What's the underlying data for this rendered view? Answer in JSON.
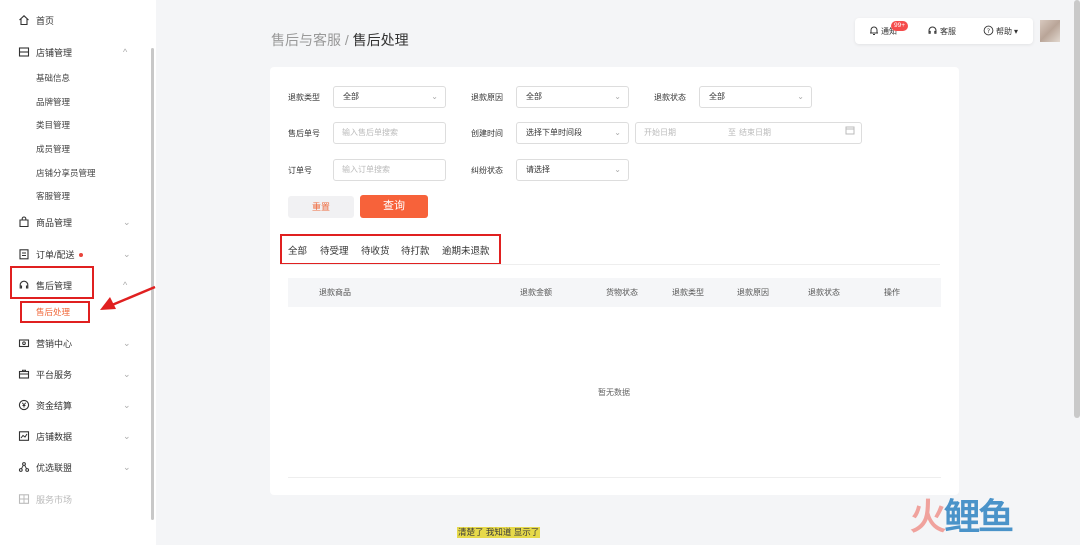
{
  "sidebar": {
    "home": "首页",
    "store_mgmt": "店铺管理",
    "store_sub": [
      "基础信息",
      "品牌管理",
      "类目管理",
      "成员管理",
      "店铺分享员管理",
      "客服管理"
    ],
    "product_mgmt": "商品管理",
    "orders": "订单/配送",
    "after_sales": "售后管理",
    "after_sales_sub": "售后处理",
    "marketing": "营销中心",
    "platform": "平台服务",
    "finance": "资金结算",
    "data": "店铺数据",
    "alliance": "优选联盟",
    "market": "服务市场"
  },
  "header": {
    "breadcrumb_parent": "售后与客服",
    "breadcrumb_sep": " / ",
    "breadcrumb_current": "售后处理",
    "notice": "通知",
    "notice_badge": "99+",
    "service": "客服",
    "help": "帮助"
  },
  "filters": {
    "refund_type_label": "退款类型",
    "refund_type_value": "全部",
    "refund_reason_label": "退款原因",
    "refund_reason_value": "全部",
    "refund_status_label": "退款状态",
    "refund_status_value": "全部",
    "after_sale_no_label": "售后单号",
    "after_sale_no_placeholder": "输入售后单搜索",
    "create_time_label": "创建时间",
    "create_time_value": "选择下单时间段",
    "start_date_placeholder": "开始日期",
    "date_sep": "至",
    "end_date_placeholder": "结束日期",
    "order_no_label": "订单号",
    "order_no_placeholder": "输入订单搜索",
    "dispute_label": "纠纷状态",
    "dispute_value": "请选择",
    "reset": "重置",
    "query": "查询"
  },
  "tabs": [
    "全部",
    "待受理",
    "待收货",
    "待打款",
    "逾期未退款"
  ],
  "table": {
    "headers": [
      "退款商品",
      "退款金额",
      "货物状态",
      "退款类型",
      "退款原因",
      "退款状态",
      "操作"
    ],
    "empty": "暂无数据"
  },
  "watermark": {
    "caption": "清楚了 我知道 显示了",
    "logo_a": "火",
    "logo_b": "鲤鱼"
  },
  "colors": {
    "accent": "#f7623a",
    "highlight_box": "#e02020"
  }
}
